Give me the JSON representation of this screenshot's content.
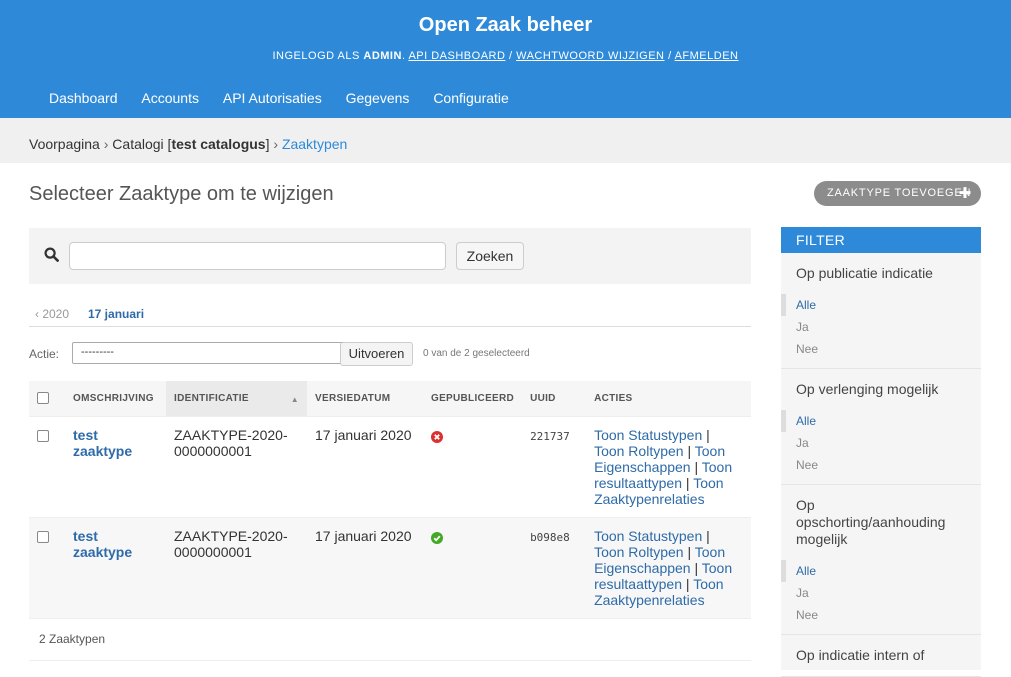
{
  "header": {
    "site_title": "Open Zaak beheer",
    "logged_in_as": "INGELOGD ALS",
    "username": "ADMIN",
    "links": [
      "API DASHBOARD",
      "WACHTWOORD WIJZIGEN",
      "AFMELDEN"
    ]
  },
  "nav": [
    "Dashboard",
    "Accounts",
    "API Autorisaties",
    "Gegevens",
    "Configuratie"
  ],
  "breadcrumbs": {
    "home": "Voorpagina",
    "catalogi_prefix": "Catalogi [",
    "catalogus": "test catalogus",
    "catalogi_suffix": "]",
    "current": "Zaaktypen"
  },
  "page_title": "Selecteer Zaaktype om te wijzigen",
  "add_button": "ZAAKTYPE TOEVOEGEN",
  "search": {
    "value": "",
    "button": "Zoeken"
  },
  "date_hierarchy": {
    "back": "‹ 2020",
    "current": "17 januari"
  },
  "actions": {
    "label": "Actie:",
    "selected": "---------",
    "run_button": "Uitvoeren",
    "counter": "0 van de 2 geselecteerd"
  },
  "table": {
    "columns": [
      "OMSCHRIJVING",
      "IDENTIFICATIE",
      "VERSIEDATUM",
      "GEPUBLICEERD",
      "UUID",
      "ACTIES"
    ],
    "rows": [
      {
        "omschrijving": "test zaaktype",
        "identificatie": "ZAAKTYPE-2020-0000000001",
        "versiedatum": "17 januari 2020",
        "gepubliceerd": false,
        "uuid": "221737",
        "acties": [
          "Toon Statustypen",
          "Toon Roltypen",
          "Toon Eigenschappen",
          "Toon resultaattypen",
          "Toon Zaaktypenrelaties"
        ]
      },
      {
        "omschrijving": "test zaaktype",
        "identificatie": "ZAAKTYPE-2020-0000000001",
        "versiedatum": "17 januari 2020",
        "gepubliceerd": true,
        "uuid": "b098e8",
        "acties": [
          "Toon Statustypen",
          "Toon Roltypen",
          "Toon Eigenschappen",
          "Toon resultaattypen",
          "Toon Zaaktypenrelaties"
        ]
      }
    ]
  },
  "paginator": "2 Zaaktypen",
  "filter": {
    "title": "FILTER",
    "groups": [
      {
        "title": "Op publicatie indicatie",
        "options": [
          "Alle",
          "Ja",
          "Nee"
        ]
      },
      {
        "title": "Op verlenging mogelijk",
        "options": [
          "Alle",
          "Ja",
          "Nee"
        ]
      },
      {
        "title": "Op opschorting/aanhouding mogelijk",
        "options": [
          "Alle",
          "Ja",
          "Nee"
        ]
      },
      {
        "title": "Op indicatie intern of",
        "options": []
      }
    ]
  },
  "colors": {
    "header_bg": "#2e8ad8",
    "link": "#2e6ba8",
    "published_yes": "#45a827",
    "published_no": "#d9312f"
  }
}
